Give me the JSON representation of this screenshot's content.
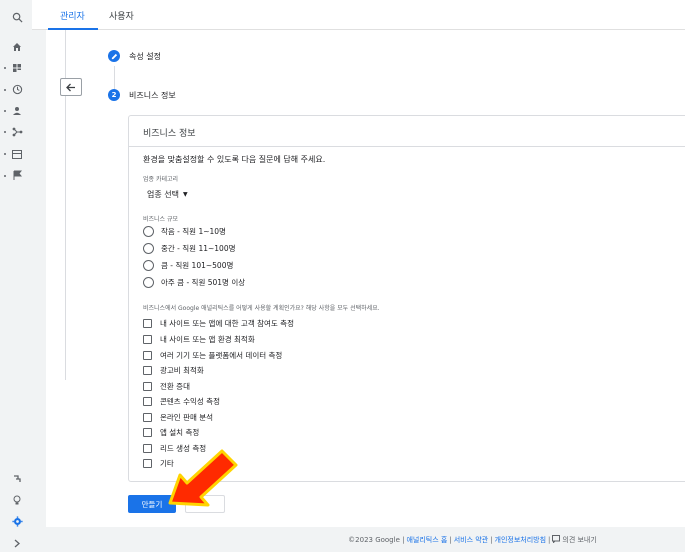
{
  "rail": {
    "icons": [
      "search-icon",
      "home-icon",
      "reports-icon",
      "explore-icon",
      "audience-icon",
      "integration-icon",
      "table-icon",
      "flag-icon",
      "connector-icon",
      "lightbulb-icon",
      "settings-icon",
      "expand-icon"
    ]
  },
  "topbar": {
    "tab_admin": "관리자",
    "tab_user": "사용자"
  },
  "steps": [
    {
      "badge": "",
      "label": "속성 설정"
    },
    {
      "badge": "2",
      "label": "비즈니스 정보"
    }
  ],
  "card": {
    "title": "비즈니스 정보",
    "intro": "환경을 맞춤설정할 수 있도록 다음 질문에 답해 주세요.",
    "category_label": "업종 카테고리",
    "category_value": "업종 선택",
    "size_label": "비즈니스 규모",
    "sizes": [
      "작음 - 직원 1~10명",
      "중간 - 직원 11~100명",
      "큼 - 직원 101~500명",
      "아주 큼 - 직원 501명 이상"
    ],
    "usage_label": "비즈니스에서 Google 애널리틱스를 어떻게 사용할 계획인가요? 해당 사항을 모두 선택하세요.",
    "usages": [
      "내 사이트 또는 앱에 대한 고객 참여도 측정",
      "내 사이트 또는 앱 환경 최적화",
      "여러 기기 또는 플랫폼에서 데이터 측정",
      "광고비 최적화",
      "전환 증대",
      "콘텐츠 수익성 측정",
      "온라인 판매 분석",
      "앱 설치 측정",
      "리드 생성 측정",
      "기타"
    ]
  },
  "actions": {
    "create": "만들기",
    "cancel": ""
  },
  "footer": {
    "copyright": "©2023 Google |",
    "home": "애널리틱스 홈",
    "sep1": "|",
    "terms": "서비스 약관",
    "sep2": "|",
    "privacy": "개인정보처리방침",
    "sep3": "|",
    "feedback": "의견 보내기"
  },
  "colors": {
    "accent": "#1a73e8",
    "arrow_fill": "#ff2a00",
    "arrow_border": "#ffd400"
  }
}
